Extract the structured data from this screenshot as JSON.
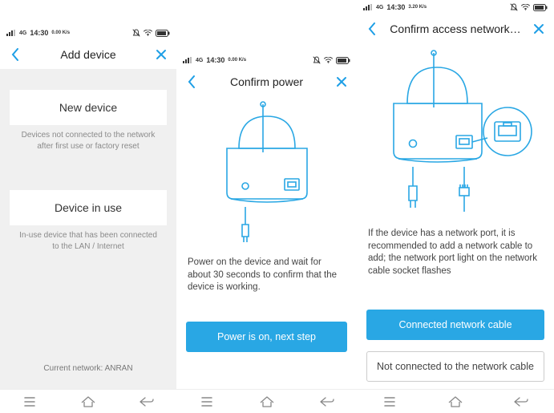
{
  "status": {
    "time": "14:30",
    "net": "4G",
    "rate": "3.20 K/s",
    "rate_small": "0.00 K/s"
  },
  "screen1": {
    "title": "Add device",
    "btn_new": "New device",
    "hint_new": "Devices not connected to the network after first use or factory reset",
    "btn_inuse": "Device in use",
    "hint_inuse": "In-use device that has been connected to the LAN / Internet",
    "current": "Current network: ANRAN"
  },
  "screen2": {
    "title": "Confirm power",
    "desc": "Power on the device and wait for about 30 seconds to confirm that the device is working.",
    "btn": "Power is on, next step"
  },
  "screen3": {
    "title": "Confirm access network…",
    "desc": "If the device has a network port, it is recommended to add a network cable to add; the network port light on the network cable socket flashes",
    "btn_primary": "Connected network cable",
    "btn_secondary": "Not connected to the network cable"
  },
  "colors": {
    "accent": "#29A7E4"
  }
}
